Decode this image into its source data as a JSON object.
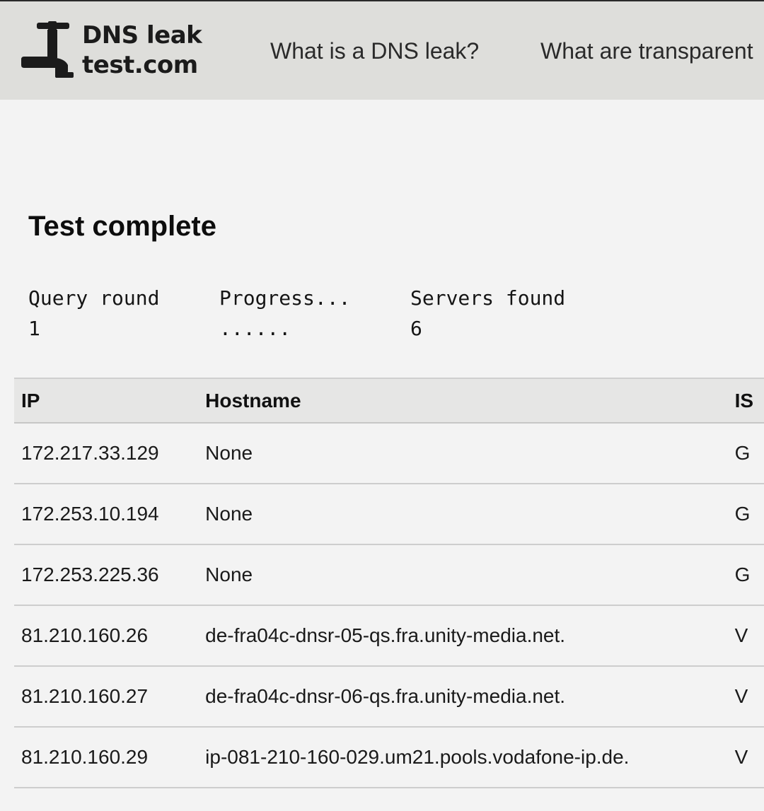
{
  "site": {
    "logo_line1": "DNS leak",
    "logo_line2": "test.com",
    "nav": [
      "What is a DNS leak?",
      "What are transparent"
    ]
  },
  "page": {
    "title": "Test complete"
  },
  "stats": {
    "query_round_label": "Query round",
    "query_round_value": "1",
    "progress_label": "Progress...",
    "progress_value": "......",
    "servers_found_label": "Servers found",
    "servers_found_value": "6"
  },
  "table": {
    "headers": [
      "IP",
      "Hostname",
      "IS"
    ],
    "rows": [
      [
        "172.217.33.129",
        "None",
        "G"
      ],
      [
        "172.253.10.194",
        "None",
        "G"
      ],
      [
        "172.253.225.36",
        "None",
        "G"
      ],
      [
        "81.210.160.26",
        "de-fra04c-dnsr-05-qs.fra.unity-media.net.",
        "V"
      ],
      [
        "81.210.160.27",
        "de-fra04c-dnsr-06-qs.fra.unity-media.net.",
        "V"
      ],
      [
        "81.210.160.29",
        "ip-081-210-160-029.um21.pools.vodafone-ip.de.",
        "V"
      ]
    ]
  },
  "colors": {
    "header_bg": "#dededb",
    "page_bg": "#f3f3f3",
    "table_head_bg": "#e6e6e5"
  },
  "icons": {
    "logo": "faucet-icon"
  }
}
